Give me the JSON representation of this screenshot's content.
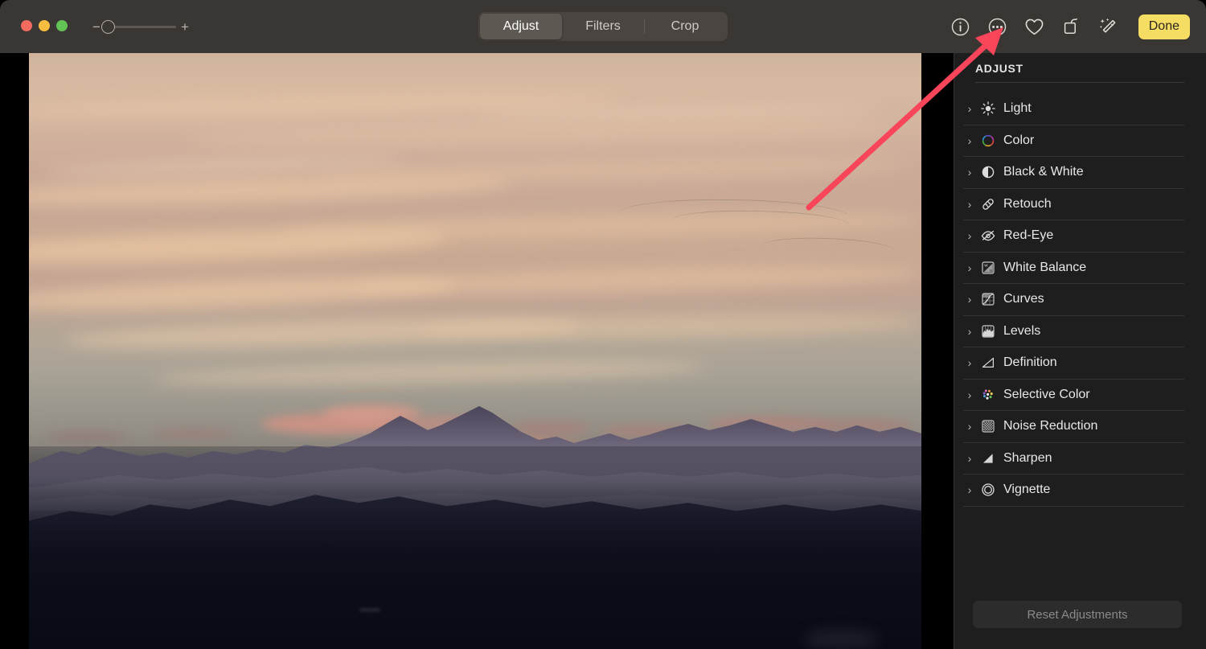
{
  "window": {
    "traffic_lights": [
      {
        "name": "close",
        "color": "#f16a5f"
      },
      {
        "name": "minimize",
        "color": "#f6bd3f"
      },
      {
        "name": "maximize",
        "color": "#61c454"
      }
    ]
  },
  "toolbar": {
    "zoom": {
      "minus_label": "−",
      "plus_label": "+",
      "value": 0
    },
    "segmented": {
      "selected": "Adjust",
      "options": [
        {
          "label": "Adjust",
          "active": true
        },
        {
          "label": "Filters",
          "active": false
        },
        {
          "label": "Crop",
          "active": false
        }
      ]
    },
    "icons": [
      {
        "name": "info-icon",
        "glyph": "i"
      },
      {
        "name": "more-options-icon",
        "glyph": "…"
      },
      {
        "name": "favorite-heart-icon",
        "glyph": "♡"
      },
      {
        "name": "rotate-icon",
        "glyph": "↺"
      },
      {
        "name": "auto-enhance-wand-icon",
        "glyph": "✨"
      }
    ],
    "done_label": "Done",
    "done_color": "#f5dc63"
  },
  "sidebar": {
    "title": "ADJUST",
    "items": [
      {
        "label": "Light",
        "icon": "brightness-sun-icon",
        "chevron": "›"
      },
      {
        "label": "Color",
        "icon": "color-wheel-icon",
        "chevron": "›"
      },
      {
        "label": "Black & White",
        "icon": "black-white-circle-icon",
        "chevron": "›"
      },
      {
        "label": "Retouch",
        "icon": "retouch-bandage-icon",
        "chevron": "›"
      },
      {
        "label": "Red-Eye",
        "icon": "red-eye-icon",
        "chevron": "›"
      },
      {
        "label": "White Balance",
        "icon": "white-balance-icon",
        "chevron": "›"
      },
      {
        "label": "Curves",
        "icon": "curves-icon",
        "chevron": "›"
      },
      {
        "label": "Levels",
        "icon": "levels-histogram-icon",
        "chevron": "›"
      },
      {
        "label": "Definition",
        "icon": "definition-icon",
        "chevron": "›"
      },
      {
        "label": "Selective Color",
        "icon": "selective-color-icon",
        "chevron": "›"
      },
      {
        "label": "Noise Reduction",
        "icon": "noise-reduction-icon",
        "chevron": "›"
      },
      {
        "label": "Sharpen",
        "icon": "sharpen-icon",
        "chevron": "›"
      },
      {
        "label": "Vignette",
        "icon": "vignette-icon",
        "chevron": "›"
      }
    ],
    "reset_label": "Reset Adjustments",
    "reset_enabled": false
  },
  "photo": {
    "description": "Mountain range at sunset with pink clouds and warm sky"
  },
  "annotation": {
    "arrow_color": "#f8455a",
    "points_to": "more-options-icon"
  }
}
